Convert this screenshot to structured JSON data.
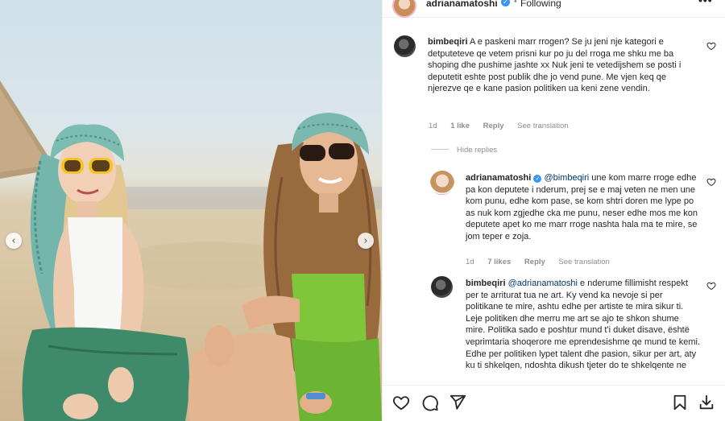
{
  "post": {
    "username": "adrianamatoshi",
    "follow_status": "Following",
    "separator": "•",
    "more_label": "•••"
  },
  "carousel": {
    "prev_label": "‹",
    "next_label": "›"
  },
  "comments": [
    {
      "username": "bimbeqiri",
      "text": "A e paskeni marr rrogen? Se ju jeni nje kategori e detputeteve qe vetem prisni kur po ju del rroga me shku me ba shoping dhe pushime jashte xx Nuk jeni te vetedijshem se posti i deputetit eshte post publik dhe jo vend pune. Me vjen keq qe njerezve qe e kane pasion politiken ua keni zene vendin.",
      "time": "1d",
      "likes": "1 like",
      "reply": "Reply",
      "see_translation": "See translation"
    },
    {
      "username": "adrianamatoshi",
      "mention": "@bimbeqiri",
      "text": "une kom marre rroge edhe pa kon deputete i nderum, prej se e maj veten ne men une kom punu, edhe kom pase, se kom shtri doren me lype po as nuk kom zgjedhe cka me punu, neser edhe mos me kon deputete apet ko me marr rroge nashta hala ma te mire, se jom teper e zoja.",
      "time": "1d",
      "likes": "7 likes",
      "reply": "Reply",
      "see_translation": "See translation"
    },
    {
      "username": "bimbeqiri",
      "mention": "@adrianamatoshi",
      "text": "e nderume fillimisht respekt per te arriturat tua ne art. Ky vend ka nevoje si per politikane te mire, ashtu edhe per artiste te mira sikur ti. Leje politiken dhe merru me art se ajo te shkon shume mire. Politika sado e poshtur mund t'i duket disave, është veprimtaria shoqerore me eprendesishme qe mund te kemi. Edhe per politiken lypet talent dhe pasion, sikur per art, aty ku ti shkelqen, ndoshta dikush tjeter do te shkelqente ne"
    }
  ],
  "hide_replies": "Hide replies",
  "icons": {
    "like": "heart-icon",
    "comment": "comment-icon",
    "share": "send-icon",
    "save": "bookmark-icon",
    "download": "download-icon"
  },
  "colors": {
    "link": "#00376b",
    "verified": "#3897f0",
    "meta": "#8e8e8e"
  }
}
